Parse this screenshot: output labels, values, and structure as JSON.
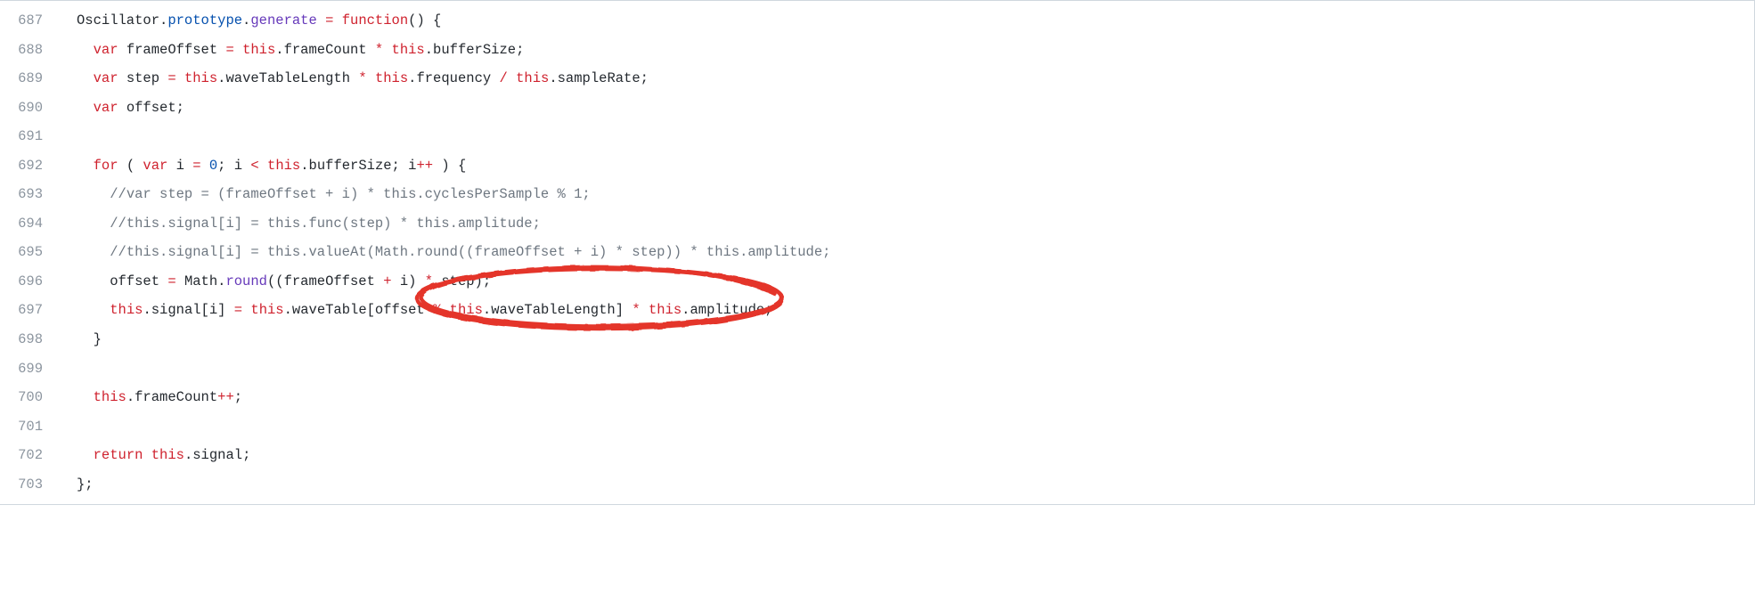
{
  "lineNumbers": [
    "687",
    "688",
    "689",
    "690",
    "691",
    "692",
    "693",
    "694",
    "695",
    "696",
    "697",
    "698",
    "699",
    "700",
    "701",
    "702",
    "703"
  ],
  "code": {
    "l687": [
      {
        "t": "Oscillator",
        "c": "id"
      },
      {
        "t": ".",
        "c": "id"
      },
      {
        "t": "prototype",
        "c": "blue"
      },
      {
        "t": ".",
        "c": "id"
      },
      {
        "t": "generate",
        "c": "fn"
      },
      {
        "t": " ",
        "c": "id"
      },
      {
        "t": "=",
        "c": "op"
      },
      {
        "t": " ",
        "c": "id"
      },
      {
        "t": "function",
        "c": "kw"
      },
      {
        "t": "() {",
        "c": "id"
      }
    ],
    "l688": [
      {
        "t": "  ",
        "c": "id"
      },
      {
        "t": "var",
        "c": "kw"
      },
      {
        "t": " frameOffset ",
        "c": "id"
      },
      {
        "t": "=",
        "c": "op"
      },
      {
        "t": " ",
        "c": "id"
      },
      {
        "t": "this",
        "c": "this"
      },
      {
        "t": ".frameCount ",
        "c": "id"
      },
      {
        "t": "*",
        "c": "op"
      },
      {
        "t": " ",
        "c": "id"
      },
      {
        "t": "this",
        "c": "this"
      },
      {
        "t": ".bufferSize;",
        "c": "id"
      }
    ],
    "l689": [
      {
        "t": "  ",
        "c": "id"
      },
      {
        "t": "var",
        "c": "kw"
      },
      {
        "t": " step ",
        "c": "id"
      },
      {
        "t": "=",
        "c": "op"
      },
      {
        "t": " ",
        "c": "id"
      },
      {
        "t": "this",
        "c": "this"
      },
      {
        "t": ".waveTableLength ",
        "c": "id"
      },
      {
        "t": "*",
        "c": "op"
      },
      {
        "t": " ",
        "c": "id"
      },
      {
        "t": "this",
        "c": "this"
      },
      {
        "t": ".frequency ",
        "c": "id"
      },
      {
        "t": "/",
        "c": "op"
      },
      {
        "t": " ",
        "c": "id"
      },
      {
        "t": "this",
        "c": "this"
      },
      {
        "t": ".sampleRate;",
        "c": "id"
      }
    ],
    "l690": [
      {
        "t": "  ",
        "c": "id"
      },
      {
        "t": "var",
        "c": "kw"
      },
      {
        "t": " offset;",
        "c": "id"
      }
    ],
    "l691": [
      {
        "t": "",
        "c": "id"
      }
    ],
    "l692": [
      {
        "t": "  ",
        "c": "id"
      },
      {
        "t": "for",
        "c": "kw"
      },
      {
        "t": " ( ",
        "c": "id"
      },
      {
        "t": "var",
        "c": "kw"
      },
      {
        "t": " i ",
        "c": "id"
      },
      {
        "t": "=",
        "c": "op"
      },
      {
        "t": " ",
        "c": "id"
      },
      {
        "t": "0",
        "c": "num"
      },
      {
        "t": "; i ",
        "c": "id"
      },
      {
        "t": "<",
        "c": "op"
      },
      {
        "t": " ",
        "c": "id"
      },
      {
        "t": "this",
        "c": "this"
      },
      {
        "t": ".bufferSize; i",
        "c": "id"
      },
      {
        "t": "++",
        "c": "op"
      },
      {
        "t": " ) {",
        "c": "id"
      }
    ],
    "l693": [
      {
        "t": "    ",
        "c": "id"
      },
      {
        "t": "//var step = (frameOffset + i) * this.cyclesPerSample % 1;",
        "c": "cmt"
      }
    ],
    "l694": [
      {
        "t": "    ",
        "c": "id"
      },
      {
        "t": "//this.signal[i] = this.func(step) * this.amplitude;",
        "c": "cmt"
      }
    ],
    "l695": [
      {
        "t": "    ",
        "c": "id"
      },
      {
        "t": "//this.signal[i] = this.valueAt(Math.round((frameOffset + i) * step)) * this.amplitude;",
        "c": "cmt"
      }
    ],
    "l696": [
      {
        "t": "    offset ",
        "c": "id"
      },
      {
        "t": "=",
        "c": "op"
      },
      {
        "t": " Math.",
        "c": "id"
      },
      {
        "t": "round",
        "c": "fn"
      },
      {
        "t": "((frameOffset ",
        "c": "id"
      },
      {
        "t": "+",
        "c": "op"
      },
      {
        "t": " i) ",
        "c": "id"
      },
      {
        "t": "*",
        "c": "op"
      },
      {
        "t": " step);",
        "c": "id"
      }
    ],
    "l697": [
      {
        "t": "    ",
        "c": "id"
      },
      {
        "t": "this",
        "c": "this"
      },
      {
        "t": ".signal[i] ",
        "c": "id"
      },
      {
        "t": "=",
        "c": "op"
      },
      {
        "t": " ",
        "c": "id"
      },
      {
        "t": "this",
        "c": "this"
      },
      {
        "t": ".waveTable[offset ",
        "c": "id"
      },
      {
        "t": "%",
        "c": "op"
      },
      {
        "t": " ",
        "c": "id"
      },
      {
        "t": "this",
        "c": "this"
      },
      {
        "t": ".waveTableLength] ",
        "c": "id"
      },
      {
        "t": "*",
        "c": "op"
      },
      {
        "t": " ",
        "c": "id"
      },
      {
        "t": "this",
        "c": "this"
      },
      {
        "t": ".amplitude;",
        "c": "id"
      }
    ],
    "l698": [
      {
        "t": "  }",
        "c": "id"
      }
    ],
    "l699": [
      {
        "t": "",
        "c": "id"
      }
    ],
    "l700": [
      {
        "t": "  ",
        "c": "id"
      },
      {
        "t": "this",
        "c": "this"
      },
      {
        "t": ".frameCount",
        "c": "id"
      },
      {
        "t": "++",
        "c": "op"
      },
      {
        "t": ";",
        "c": "id"
      }
    ],
    "l701": [
      {
        "t": "",
        "c": "id"
      }
    ],
    "l702": [
      {
        "t": "  ",
        "c": "id"
      },
      {
        "t": "return",
        "c": "kw"
      },
      {
        "t": " ",
        "c": "id"
      },
      {
        "t": "this",
        "c": "this"
      },
      {
        "t": ".signal;",
        "c": "id"
      }
    ],
    "l703": [
      {
        "t": "};",
        "c": "id"
      }
    ]
  },
  "annotation": {
    "type": "hand-drawn-ellipse",
    "color": "#e4342a",
    "targetLine": 697,
    "description": "circles the expression [offset % this.waveTableLength]"
  }
}
